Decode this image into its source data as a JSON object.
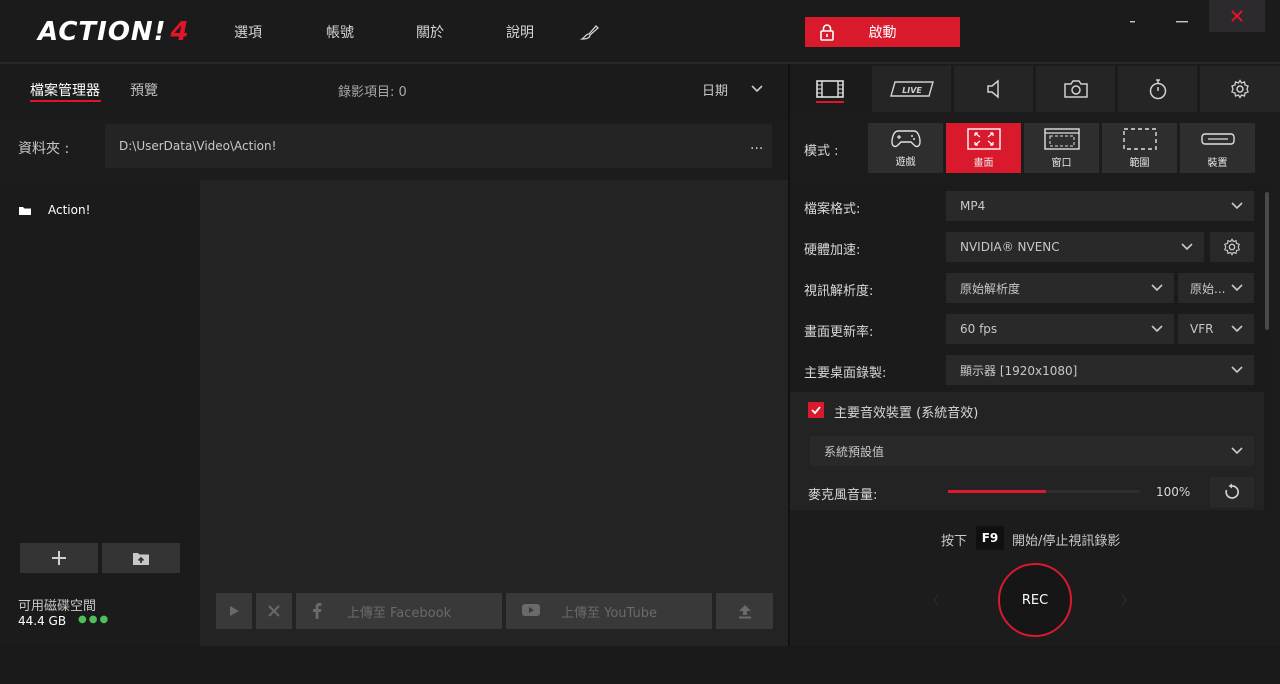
{
  "app": {
    "logo_text": "ACTION!",
    "logo_version": "4"
  },
  "menu": {
    "options": "選項",
    "account": "帳號",
    "about": "關於",
    "help": "說明"
  },
  "activate_label": "啟動",
  "left": {
    "tab_file_manager": "檔案管理器",
    "tab_preview": "預覽",
    "recording_count": "錄影項目: 0",
    "sort_by": "日期",
    "folder_label": "資料夾 :",
    "folder_path": "D:\\UserData\\Video\\Action!",
    "folder_more": "...",
    "tree_items": [
      {
        "label": "Action!"
      }
    ],
    "disk_label": "可用磁碟空間",
    "disk_size": "44.4 GB",
    "disk_dots": "●●●",
    "upload_facebook": "上傳至 Facebook",
    "upload_youtube": "上傳至 YouTube"
  },
  "right": {
    "mode_label": "模式 :",
    "modes": [
      {
        "label": "遊戲",
        "icon": "gamepad-icon"
      },
      {
        "label": "畫面",
        "icon": "fullscreen-icon",
        "active": true
      },
      {
        "label": "窗口",
        "icon": "window-icon"
      },
      {
        "label": "範圍",
        "icon": "region-icon"
      },
      {
        "label": "裝置",
        "icon": "device-icon"
      }
    ],
    "settings": {
      "file_format": {
        "label": "檔案格式:",
        "value": "MP4"
      },
      "hw_accel": {
        "label": "硬體加速:",
        "value": "NVIDIA® NVENC"
      },
      "resolution": {
        "label": "視訊解析度:",
        "value": "原始解析度",
        "secondary": "原始..."
      },
      "framerate": {
        "label": "畫面更新率:",
        "value": "60 fps",
        "secondary": "VFR"
      },
      "desktop": {
        "label": "主要桌面錄製:",
        "value": "顯示器 [1920x1080]"
      }
    },
    "audio": {
      "checkbox_label": "主要音效裝置 (系統音效)",
      "checked": true,
      "device": "系統預設值"
    },
    "mic": {
      "label": "麥克風音量:",
      "value_text": "100%",
      "level": 0.51
    },
    "hint": {
      "press": "按下",
      "key": "F9",
      "rest": "開始/停止視訊錄影"
    },
    "rec_label": "REC"
  },
  "colors": {
    "accent": "#d9192c",
    "background": "#1c1b1c",
    "disk_ok": "#4fbf5a"
  }
}
